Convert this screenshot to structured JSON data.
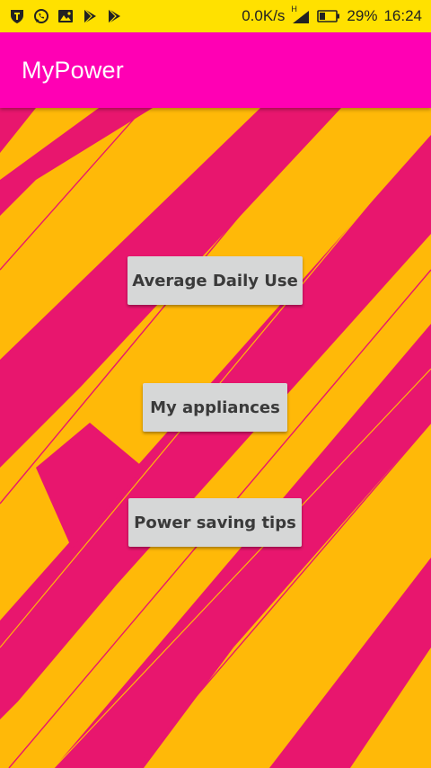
{
  "status_bar": {
    "icons_left": [
      "vpn-shield-icon",
      "whatsapp-icon",
      "image-icon",
      "play-store-icon",
      "play-store-icon"
    ],
    "network_speed": "0.0K/s",
    "network_type": "H",
    "battery_percent": "29%",
    "time": "16:24"
  },
  "app_bar": {
    "title": "MyPower"
  },
  "main": {
    "buttons": [
      {
        "label": "Average Daily Use"
      },
      {
        "label": "My appliances"
      },
      {
        "label": "Power saving tips"
      }
    ]
  },
  "colors": {
    "status_bar_bg": "#FFE100",
    "app_bar_bg": "#FF00B4",
    "background_yellow": "#FFB908",
    "background_pink": "#E8166E",
    "button_bg": "#D6D7D7"
  }
}
